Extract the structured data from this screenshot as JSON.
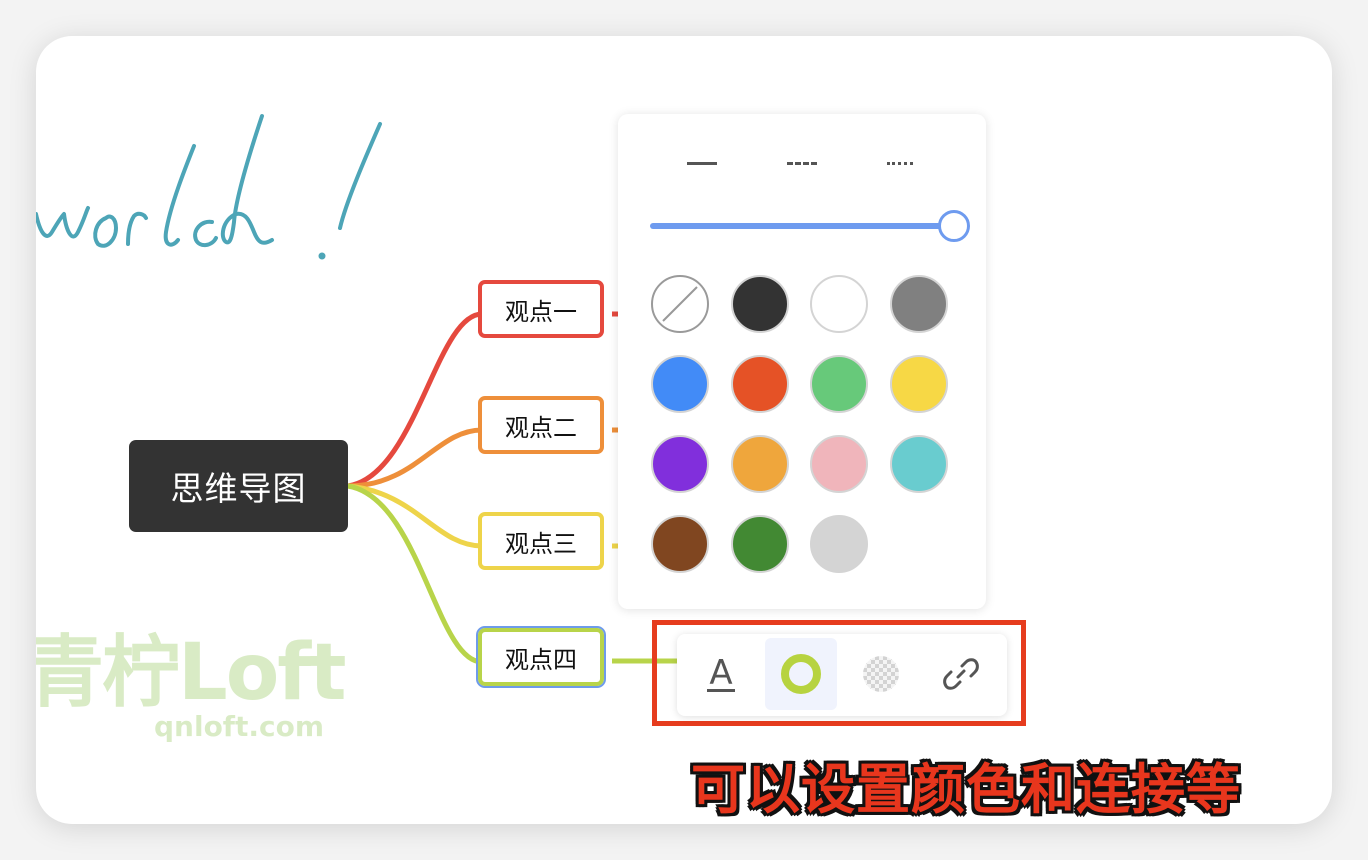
{
  "mindmap": {
    "root": {
      "label": "思维导图",
      "color": "#333333"
    },
    "children": [
      {
        "label": "观点一",
        "color": "#e5493e"
      },
      {
        "label": "观点二",
        "color": "#ee8f3a"
      },
      {
        "label": "观点三",
        "color": "#eed44a"
      },
      {
        "label": "观点四",
        "color": "#b8d44a",
        "selected": true
      }
    ]
  },
  "handwriting": {
    "text": "world !",
    "color": "#4da5b7"
  },
  "popover": {
    "line_styles": [
      "solid",
      "dashed",
      "dotted"
    ],
    "thickness": {
      "value": 1.0,
      "color": "#6e9bef"
    },
    "colors": [
      {
        "name": "none",
        "hex": "transparent"
      },
      {
        "name": "black",
        "hex": "#333333"
      },
      {
        "name": "white",
        "hex": "#ffffff"
      },
      {
        "name": "gray",
        "hex": "#808080"
      },
      {
        "name": "blue",
        "hex": "#428bf7"
      },
      {
        "name": "red-orange",
        "hex": "#e55226"
      },
      {
        "name": "green",
        "hex": "#67c97a"
      },
      {
        "name": "yellow",
        "hex": "#f7d845"
      },
      {
        "name": "purple",
        "hex": "#812fdc"
      },
      {
        "name": "orange",
        "hex": "#efa63c"
      },
      {
        "name": "pink",
        "hex": "#f0b5bb"
      },
      {
        "name": "teal",
        "hex": "#69cccf"
      },
      {
        "name": "brown",
        "hex": "#804620"
      },
      {
        "name": "dark-green",
        "hex": "#428933"
      },
      {
        "name": "light-gray",
        "hex": "#d4d4d4"
      }
    ]
  },
  "toolbar": {
    "text_icon": "A",
    "items": [
      "text-color-icon",
      "stroke-color-icon",
      "fill-color-icon",
      "link-icon"
    ],
    "active": "stroke-color-icon",
    "stroke_color": "#b7d340"
  },
  "caption": {
    "text": "可以设置颜色和连接等",
    "color": "#e8361d"
  },
  "watermark": {
    "brand": "青柠Loft",
    "domain": "qnloft.com"
  }
}
